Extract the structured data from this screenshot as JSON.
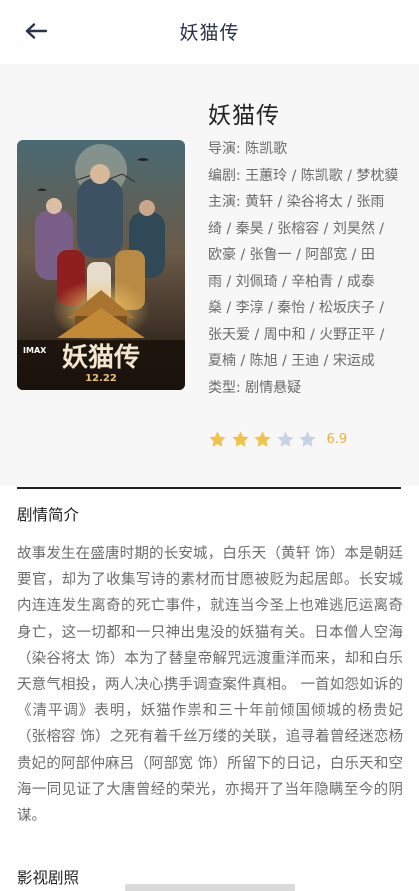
{
  "header": {
    "title": "妖猫传"
  },
  "movie": {
    "title": "妖猫传",
    "director": "导演: 陈凯歌",
    "writers": "编剧: 王蕙玲 / 陈凯歌 / 梦枕貘",
    "cast_lines": [
      "主演: 黄轩 / 染谷将太 / 张雨",
      "绮 / 秦昊 / 张榕容 / 刘昊然 /",
      "欧豪 / 张鲁一 / 阿部宽 / 田",
      "雨 / 刘佩琦 / 辛柏青 / 成泰",
      "燊 / 李淳 / 秦怡 / 松坂庆子 /",
      "张天爱 / 周中和 / 火野正平 /",
      "夏楠 / 陈旭 / 王迪 / 宋运成"
    ],
    "genre": "类型: 剧情悬疑",
    "rating": 6.9,
    "rating_text": "6.9",
    "stars_filled": 3,
    "stars_total": 5,
    "poster": {
      "title_art": "妖猫传",
      "badge": "IMAX",
      "date": "12.22"
    }
  },
  "synopsis": {
    "heading": "剧情简介",
    "text": "故事发生在盛唐时期的长安城，白乐天（黄轩 饰）本是朝廷要官，却为了收集写诗的素材而甘愿被贬为起居郎。长安城内连连发生离奇的死亡事件，就连当今圣上也难逃厄运离奇身亡，这一切都和一只神出鬼没的妖猫有关。日本僧人空海（染谷将太 饰）本为了替皇帝解咒远渡重洋而来，却和白乐天意气相投，两人决心携手调查案件真相。 一首如怨如诉的《清平调》表明，妖猫作祟和三十年前倾国倾城的杨贵妃（张榕容 饰）之死有着千丝万缕的关联，追寻着曾经迷恋杨贵妃的阿部仲麻吕（阿部宽 饰）所留下的日记，白乐天和空海一同见证了大唐曾经的荣光，亦揭开了当年隐瞒至今的阴谋。"
  },
  "stills": {
    "heading": "影视剧照"
  },
  "colors": {
    "star_filled": "#f2c24b",
    "star_empty": "#c9d3e6",
    "score": "#e8b13a",
    "title": "#2a3347"
  }
}
